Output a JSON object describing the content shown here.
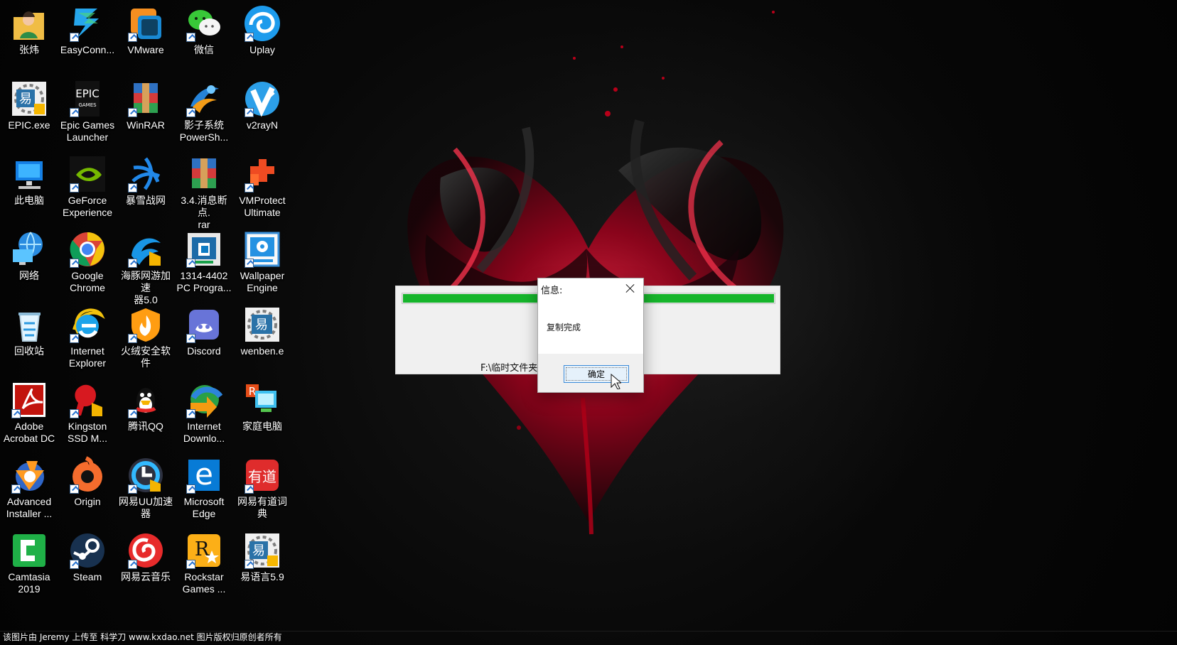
{
  "desktop": {
    "icons": [
      {
        "label": "张炜",
        "icon": "user-folder-icon"
      },
      {
        "label": "EasyConn...",
        "icon": "easyconnect-icon"
      },
      {
        "label": "VMware",
        "icon": "vmware-icon"
      },
      {
        "label": "微信",
        "icon": "wechat-icon"
      },
      {
        "label": "Uplay",
        "icon": "uplay-icon"
      },
      {
        "label": "EPIC.exe",
        "icon": "epic-exe-icon"
      },
      {
        "label": "Epic Games\nLauncher",
        "icon": "epic-games-icon"
      },
      {
        "label": "WinRAR",
        "icon": "winrar-icon"
      },
      {
        "label": "影子系统\nPowerSh...",
        "icon": "shadow-system-icon"
      },
      {
        "label": "v2rayN",
        "icon": "v2rayn-icon"
      },
      {
        "label": "此电脑",
        "icon": "this-pc-icon"
      },
      {
        "label": "GeForce\nExperience",
        "icon": "geforce-icon"
      },
      {
        "label": "暴雪战网",
        "icon": "battlenet-icon"
      },
      {
        "label": "3.4.消息断点.\nrar",
        "icon": "rar-file-icon"
      },
      {
        "label": "VMProtect\nUltimate",
        "icon": "vmprotect-icon"
      },
      {
        "label": "网络",
        "icon": "network-icon"
      },
      {
        "label": "Google\nChrome",
        "icon": "chrome-icon"
      },
      {
        "label": "海豚网游加速\n器5.0",
        "icon": "dolphin-accelerator-icon"
      },
      {
        "label": "1314-4402\nPC Progra...",
        "icon": "pc-program-icon"
      },
      {
        "label": "Wallpaper\nEngine",
        "icon": "wallpaper-engine-icon"
      },
      {
        "label": "回收站",
        "icon": "recycle-bin-icon"
      },
      {
        "label": "Internet\nExplorer",
        "icon": "internet-explorer-icon"
      },
      {
        "label": "火绒安全软件",
        "icon": "huorong-security-icon"
      },
      {
        "label": "Discord",
        "icon": "discord-icon"
      },
      {
        "label": "wenben.e",
        "icon": "wenben-icon"
      },
      {
        "label": "Adobe\nAcrobat DC",
        "icon": "acrobat-icon"
      },
      {
        "label": "Kingston\nSSD M...",
        "icon": "kingston-icon"
      },
      {
        "label": "腾讯QQ",
        "icon": "qq-icon"
      },
      {
        "label": "Internet\nDownlo...",
        "icon": "internet-download-icon"
      },
      {
        "label": "家庭电脑",
        "icon": "home-computer-icon"
      },
      {
        "label": "Advanced\nInstaller ...",
        "icon": "advanced-installer-icon"
      },
      {
        "label": "Origin",
        "icon": "origin-icon"
      },
      {
        "label": "网易UU加速\n器",
        "icon": "uu-accelerator-icon"
      },
      {
        "label": "Microsoft\nEdge",
        "icon": "edge-icon"
      },
      {
        "label": "网易有道词典",
        "icon": "youdao-dictionary-icon"
      },
      {
        "label": "Camtasia\n2019",
        "icon": "camtasia-icon"
      },
      {
        "label": "Steam",
        "icon": "steam-icon"
      },
      {
        "label": "网易云音乐",
        "icon": "netease-music-icon"
      },
      {
        "label": "Rockstar\nGames ...",
        "icon": "rockstar-icon"
      },
      {
        "label": "易语言5.9",
        "icon": "eyuyan-icon"
      }
    ]
  },
  "progress_panel": {
    "path": "F:\\临时文件夹",
    "progress_percent": 100,
    "fill_color": "#16b52b"
  },
  "dialog": {
    "title": "信息:",
    "message": "复制完成",
    "ok_label": "确定"
  },
  "watermark": "该图片由 Jeremy 上传至 科学刀 www.kxdao.net 图片版权归原创者所有"
}
